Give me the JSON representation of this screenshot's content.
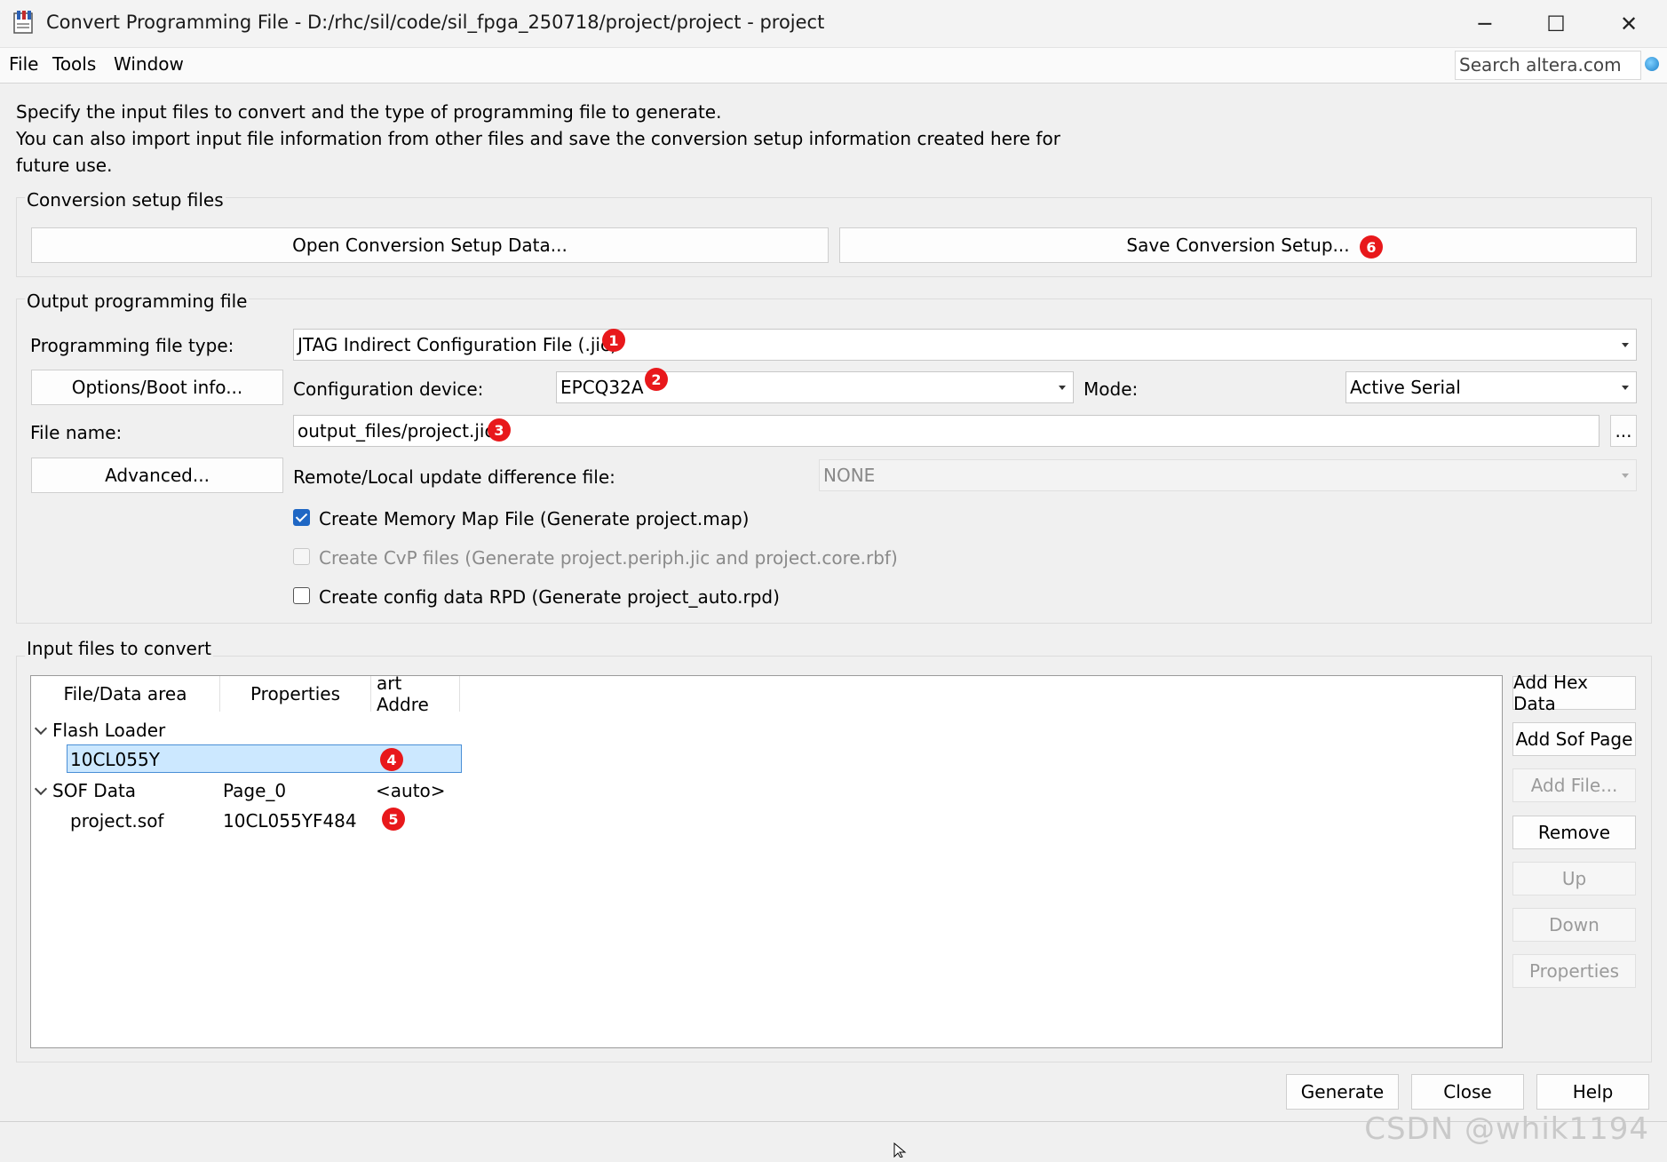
{
  "window": {
    "title": "Convert Programming File - D:/rhc/sil/code/sil_fpga_250718/project/project - project",
    "app_icon": "quartus-programmer-icon",
    "controls": {
      "minimize": "─",
      "maximize": "☐",
      "close": "✕"
    }
  },
  "menu": {
    "items": [
      "File",
      "Tools",
      "Window"
    ]
  },
  "search": {
    "placeholder": "Search altera.com"
  },
  "intro": {
    "line1": "Specify the input files to convert and the type of programming file to generate.",
    "line2": "You can also import input file information from other files and save the conversion setup information created here for",
    "line3": "future use."
  },
  "setup": {
    "label": "Conversion setup files",
    "open_button": "Open Conversion Setup Data...",
    "save_button": "Save Conversion Setup..."
  },
  "output": {
    "label": "Output programming file",
    "file_type_label": "Programming file type:",
    "file_type_value": "JTAG Indirect Configuration File (.jic)",
    "options_button": "Options/Boot info...",
    "config_device_label": "Configuration device:",
    "config_device_value": "EPCQ32A",
    "mode_label": "Mode:",
    "mode_value": "Active Serial",
    "file_name_label": "File name:",
    "file_name_value": "output_files/project.jic",
    "browse_button": "...",
    "advanced_button": "Advanced...",
    "remote_label": "Remote/Local update difference file:",
    "remote_value": "NONE",
    "chk_memory_map": "Create Memory Map File (Generate project.map)",
    "chk_memory_map_checked": true,
    "chk_cvp": "Create CvP files (Generate project.periph.jic and project.core.rbf)",
    "chk_cvp_checked": false,
    "chk_rpd": "Create config data RPD (Generate project_auto.rpd)",
    "chk_rpd_checked": false
  },
  "input": {
    "label": "Input files to convert",
    "columns": [
      "File/Data area",
      "Properties",
      "art Addre"
    ],
    "flash_loader": {
      "name": "Flash Loader",
      "device": "10CL055Y"
    },
    "sof_data": {
      "name": "SOF Data",
      "page": "Page_0",
      "address": "<auto>"
    },
    "sof_file": {
      "name": "project.sof",
      "device": "10CL055YF484"
    },
    "buttons": {
      "add_hex": "Add Hex Data",
      "add_sof_page": "Add Sof Page",
      "add_file": "Add File...",
      "remove": "Remove",
      "up": "Up",
      "down": "Down",
      "properties": "Properties"
    }
  },
  "footer": {
    "generate": "Generate",
    "close": "Close",
    "help": "Help"
  },
  "badges": {
    "b1": "1",
    "b2": "2",
    "b3": "3",
    "b4": "4",
    "b5": "5",
    "b6": "6"
  },
  "watermark": "CSDN @whik1194",
  "colors": {
    "badge": "#e8181b",
    "selection": "#cce8ff",
    "check": "#1f67c4"
  }
}
